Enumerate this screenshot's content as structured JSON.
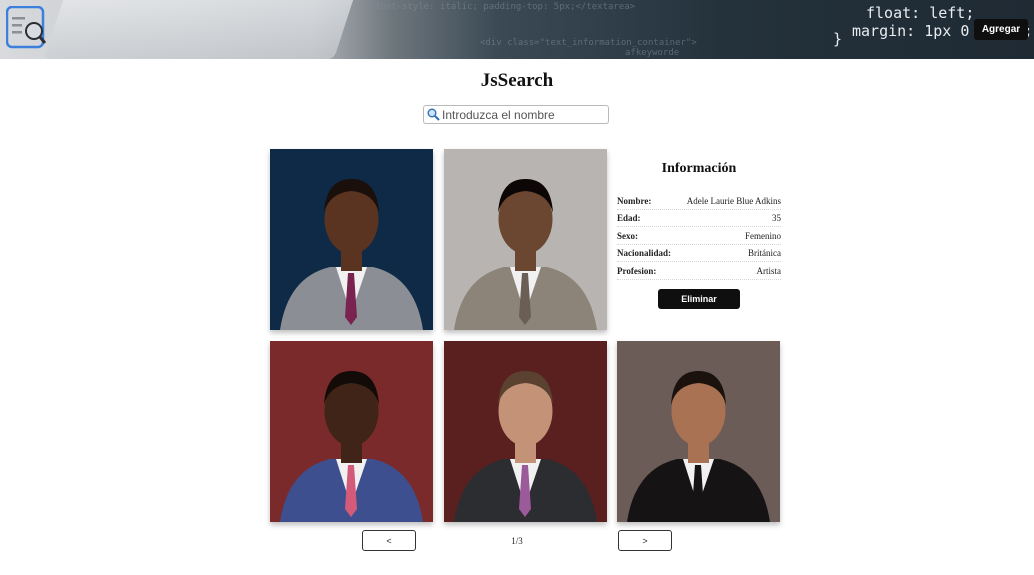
{
  "header": {
    "add_label": "Agregar",
    "banner_code": [
      "float: left;",
      "margin: 1px 0 0 3px;",
      "}"
    ],
    "banner_faint": [
      "font-style: italic; padding-top: 5px;</textarea>",
      "<div class=\"text_information_container\">",
      "afkeyworde"
    ]
  },
  "page": {
    "title": "JsSearch"
  },
  "search": {
    "placeholder": "Introduzca el nombre",
    "value": ""
  },
  "info": {
    "heading": "Información",
    "fields": [
      {
        "label": "Nombre:",
        "value": "Adele Laurie Blue Adkins"
      },
      {
        "label": "Edad:",
        "value": "35"
      },
      {
        "label": "Sexo:",
        "value": "Femenino"
      },
      {
        "label": "Nacionalidad:",
        "value": "Británica"
      },
      {
        "label": "Profesion:",
        "value": "Artista"
      }
    ],
    "delete_label": "Eliminar"
  },
  "people": [
    {
      "id": "person-1",
      "bg": "#0e2a47",
      "skin": "#5a3420",
      "suit": "#8b8f95",
      "hair": "#1a0f0a",
      "tie": "#7a2350"
    },
    {
      "id": "person-2",
      "bg": "#b7b4b2",
      "skin": "#6b4630",
      "suit": "#8d8479",
      "hair": "#0c0706",
      "tie": "#6a5e55"
    },
    {
      "id": "person-3",
      "bg": "#7a2a2a",
      "skin": "#3f2417",
      "suit": "#3d4f8f",
      "hair": "#120b08",
      "tie": "#d45a7a"
    },
    {
      "id": "person-4",
      "bg": "#5a1f1f",
      "skin": "#c49377",
      "suit": "#2c2d31",
      "hair": "#5a4130",
      "tie": "#9b5a9a"
    },
    {
      "id": "person-5",
      "bg": "#6b5c57",
      "skin": "#a87253",
      "suit": "#151313",
      "hair": "#1c120d",
      "tie": "#151313"
    }
  ],
  "pagination": {
    "prev": "<",
    "next": ">",
    "page": "1/3"
  },
  "colors": {
    "button_bg": "#0f0f10",
    "logo_blue": "#3d7fdc"
  }
}
